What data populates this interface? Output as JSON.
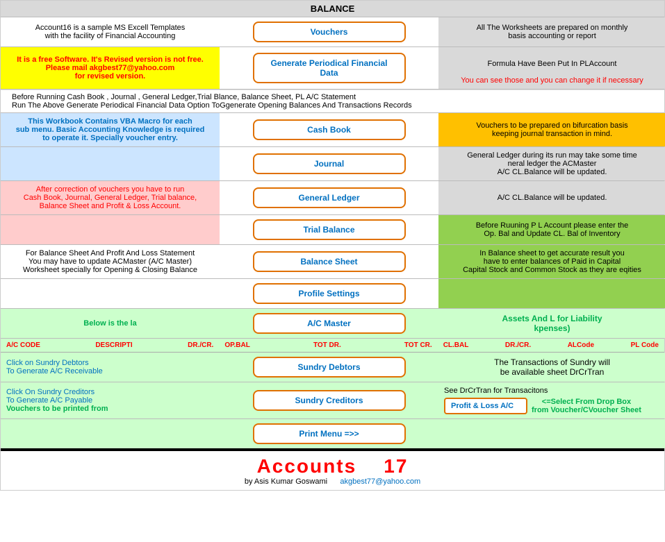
{
  "header": {
    "balance_label": "BALANCE"
  },
  "row1": {
    "left": "Account16 is a sample MS Excell Templates\nwith the facility of Financial Accounting",
    "button": "Vouchers",
    "right": "All The Worksheets are prepared on monthly\nbasis accounting or report"
  },
  "row2": {
    "left": "It is a free Software. It's Revised version is not free.  Please mail akgbest77@yahoo.com\nfor revised version.",
    "button": "Generate Periodical Financial Data",
    "right": "Formula Have Been Put In PLAccount\nYou can see those and you can change it if necessary"
  },
  "notes": {
    "line1": "Before Running Cash Book , Journal , General Ledger,Trial Blance, Balance Sheet, PL A/C Statement",
    "line2": "Run The Above Generate Periodical Financial Data Option ToGgenerate Opening Balances And Transactions Records"
  },
  "row3": {
    "left": "This Workbook Contains VBA Macro for each\nsub menu. Basic Accounting Knowledge is required\nto operate it. Specially voucher entry.",
    "button": "Cash Book",
    "right": "Vouchers to be prepared on bifurcation basis\nkeeping journal transaction in mind."
  },
  "row4": {
    "button": "Journal",
    "right": "General Ledger during its run may take some time\nneral ledger the ACMaster\nA/C CL.Balance will be updated."
  },
  "row5": {
    "left": "After correction of vouchers you have to run\nCash Book, Journal, General Ledger, Trial balance,\nBalance Sheet and Profit & Loss Account.",
    "button": "General Ledger",
    "right": "A/C CL.Balance will be updated."
  },
  "row6": {
    "button": "Trial Balance",
    "right": "Before Ruuning P L Account please enter the\nOp. Bal and Update CL. Bal of Inventory"
  },
  "row7": {
    "left": "For Balance Sheet And Profit And Loss Statement\nYou may have to update ACMaster (A/C Master)\nWorksheet specially for Opening & Closing Balance",
    "button": "Balance Sheet",
    "right": "In Balance sheet to get accurate result you\nhave to enter balances of Paid in Capital\nCapital Stock and Common Stock as they are eqities"
  },
  "row8": {
    "button": "Profile Settings"
  },
  "row9": {
    "left": "Below is the la",
    "button": "A/C Master",
    "right": "Assets And L for Liability\nkpenses)"
  },
  "bottom_header": {
    "ac_code": "A/C CODE",
    "descripti": "DESCRIPTI",
    "dr_cr": "DR./CR.",
    "op_bal": "OP.BAL",
    "tot_dr": "TOT DR.",
    "tot_cr": "TOT CR.",
    "cl_bal": "CL.BAL",
    "dr_cr2": "DR./CR.",
    "al_code": "ALCode",
    "pl_code": "PL Code"
  },
  "row_debtors": {
    "left": "Click on Sundry Debtors\nTo Generate A/C Receivable",
    "button": "Sundry Debtors",
    "right": "The Transactions of Sundry will\nbe available sheet DrCrTran"
  },
  "row_creditors": {
    "left": "Click On Sundry Creditors\nTo Generate A/C Payable\nVouchers to be printed from",
    "button": "Sundry Creditors",
    "right": "See DrCrTran for Transacitons"
  },
  "row_print": {
    "button": "Print Menu =>>",
    "pl_label": "Profit & Loss A/C",
    "pl_note": "<=Select From Drop Box\nfrom Voucher/CVoucher Sheet"
  },
  "footer": {
    "title": "Accounts",
    "number": "17",
    "by_label": "by Asis Kumar Goswami",
    "email": "akgbest77@yahoo.com"
  }
}
